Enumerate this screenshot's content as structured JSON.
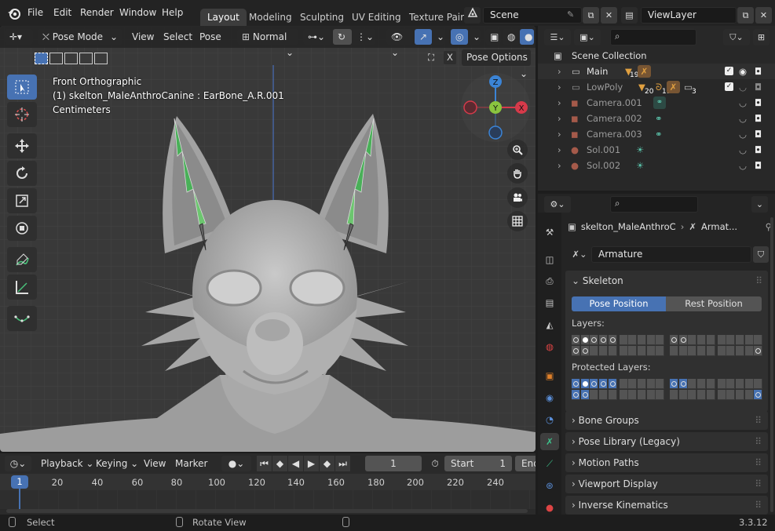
{
  "menubar": {
    "items": [
      "File",
      "Edit",
      "Render",
      "Window",
      "Help"
    ]
  },
  "workspaces": {
    "tabs": [
      "Layout",
      "Modeling",
      "Sculpting",
      "UV Editing",
      "Texture Pair"
    ],
    "active": "Layout"
  },
  "scene": {
    "name": "Scene"
  },
  "view_layer": {
    "name": "ViewLayer"
  },
  "viewport": {
    "mode": "Pose Mode",
    "menus": [
      "View",
      "Select",
      "Pose"
    ],
    "orientation": "Normal",
    "pose_options": "Pose Options",
    "info": [
      "Front Orthographic",
      "(1) skelton_MaleAnthroCanine : EarBone_A.R.001",
      "Centimeters"
    ],
    "gizmo": {
      "z": "Z",
      "y": "Y",
      "x": "X"
    },
    "colors": {
      "x": "#d63a4a",
      "y": "#8ac43f",
      "z": "#3b84d6",
      "bone": "#49b058",
      "active_blue": "#4772b3"
    }
  },
  "timeline": {
    "menus": [
      "Playback",
      "Keying",
      "View",
      "Marker"
    ],
    "current_frame": "1",
    "start_label": "Start",
    "start_value": "1",
    "end_label": "End",
    "ruler": [
      "1",
      "20",
      "40",
      "60",
      "80",
      "100",
      "120",
      "140",
      "160",
      "180",
      "200",
      "220",
      "240"
    ]
  },
  "outliner": {
    "search_placeholder": "",
    "root": "Scene Collection",
    "rows": [
      {
        "name": "Main",
        "badge": "19"
      },
      {
        "name": "LowPoly",
        "badges": [
          "20",
          "11",
          "3"
        ]
      },
      {
        "name": "Camera.001"
      },
      {
        "name": "Camera.002"
      },
      {
        "name": "Camera.003"
      },
      {
        "name": "Sol.001"
      },
      {
        "name": "Sol.002"
      }
    ]
  },
  "properties": {
    "breadcrumb": [
      "skelton_MaleAnthroC",
      "Armat..."
    ],
    "data_name": "Armature",
    "skeleton_panel": "Skeleton",
    "pose_position": "Pose Position",
    "rest_position": "Rest Position",
    "layers_label": "Layers:",
    "protected_label": "Protected Layers:",
    "collapsed_panels": [
      "Bone Groups",
      "Pose Library (Legacy)",
      "Motion Paths",
      "Viewport Display",
      "Inverse Kinematics"
    ]
  },
  "statusbar": {
    "left": "Select",
    "middle": "Rotate View",
    "version": "3.3.12"
  }
}
